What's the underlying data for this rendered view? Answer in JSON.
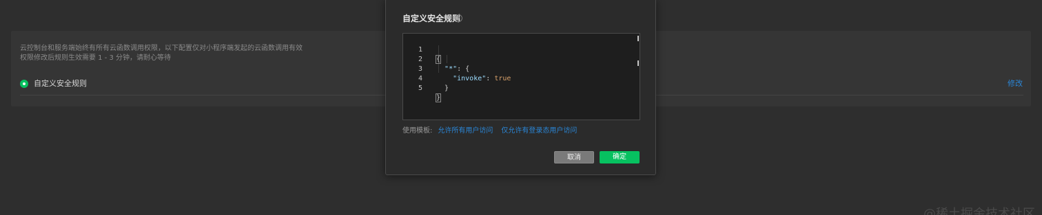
{
  "background": {
    "description_lines": [
      "云控制台和服务端始终有所有云函数调用权限，以下配置仅对小程序端发起的云函数调用有效",
      "权限修改后规则生效需要 1 - 3 分钟，请耐心等待"
    ],
    "rule_option_label": "自定义安全规则",
    "rule_option_selected": true,
    "edit_label": "修改",
    "watermark": "@稀土掘金技术社区"
  },
  "modal": {
    "title": "自定义安全规则",
    "help_icon": "question-circle-icon",
    "editor": {
      "line_numbers": [
        "1",
        "2",
        "3",
        "4",
        "5"
      ],
      "lines": [
        {
          "punc_before": "{",
          "key": "",
          "punc_after": "",
          "value": ""
        },
        {
          "punc_before": "  ",
          "key": "\"*\"",
          "punc_after": ": {",
          "value": ""
        },
        {
          "punc_before": "    ",
          "key": "\"invoke\"",
          "punc_after": ": ",
          "value": "true"
        },
        {
          "punc_before": "  }",
          "key": "",
          "punc_after": "",
          "value": ""
        },
        {
          "punc_before": "}",
          "key": "",
          "punc_after": "",
          "value": ""
        }
      ]
    },
    "template_label": "使用模板:",
    "template_links": [
      "允许所有用户访问",
      "仅允许有登录态用户访问"
    ],
    "cancel_label": "取消",
    "confirm_label": "确定"
  },
  "colors": {
    "accent_green": "#07c160",
    "link_blue": "#2b86d6",
    "background": "#2e2e2e"
  }
}
